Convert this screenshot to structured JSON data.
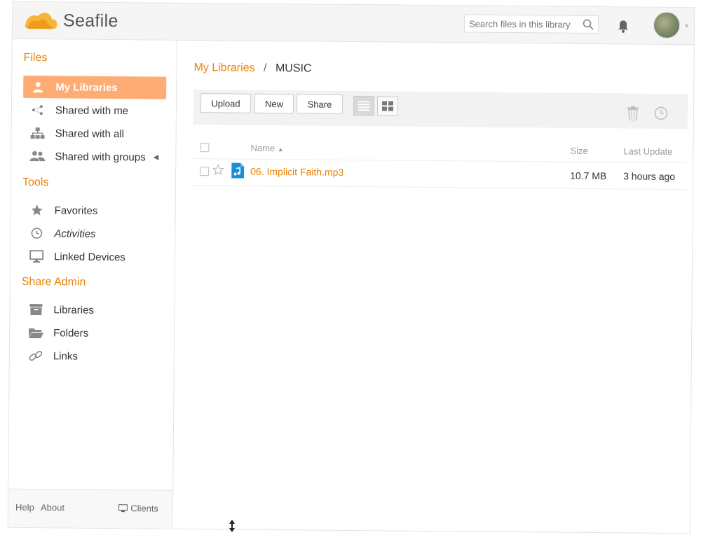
{
  "app": {
    "name": "Seafile"
  },
  "header": {
    "search_placeholder": "Search files in this library"
  },
  "sidebar": {
    "files_heading": "Files",
    "files_items": [
      {
        "label": "My Libraries",
        "icon": "user-icon",
        "active": true
      },
      {
        "label": "Shared with me",
        "icon": "share-icon"
      },
      {
        "label": "Shared with all",
        "icon": "org-icon"
      },
      {
        "label": "Shared with groups",
        "icon": "group-icon"
      }
    ],
    "tools_heading": "Tools",
    "tools_items": [
      {
        "label": "Favorites",
        "icon": "star-icon"
      },
      {
        "label": "Activities",
        "icon": "history-icon"
      },
      {
        "label": "Linked Devices",
        "icon": "monitor-icon"
      }
    ],
    "share_admin_heading": "Share Admin",
    "share_admin_items": [
      {
        "label": "Libraries",
        "icon": "archive-icon"
      },
      {
        "label": "Folders",
        "icon": "folder-icon"
      },
      {
        "label": "Links",
        "icon": "link-icon"
      }
    ],
    "footer": {
      "help": "Help",
      "about": "About",
      "clients": "Clients"
    }
  },
  "main": {
    "breadcrumb": {
      "root": "My Libraries",
      "separator": "/",
      "current": "MUSIC"
    },
    "toolbar": {
      "upload": "Upload",
      "new": "New",
      "share": "Share"
    },
    "table": {
      "columns": {
        "name": "Name",
        "size": "Size",
        "last_update": "Last Update"
      },
      "rows": [
        {
          "name": "06. Implicit Faith.mp3",
          "size": "10.7 MB",
          "last_update": "3 hours ago",
          "icon": "music-file-icon"
        }
      ]
    }
  },
  "colors": {
    "accent": "#eb8205",
    "active_bg": "#feac74"
  }
}
